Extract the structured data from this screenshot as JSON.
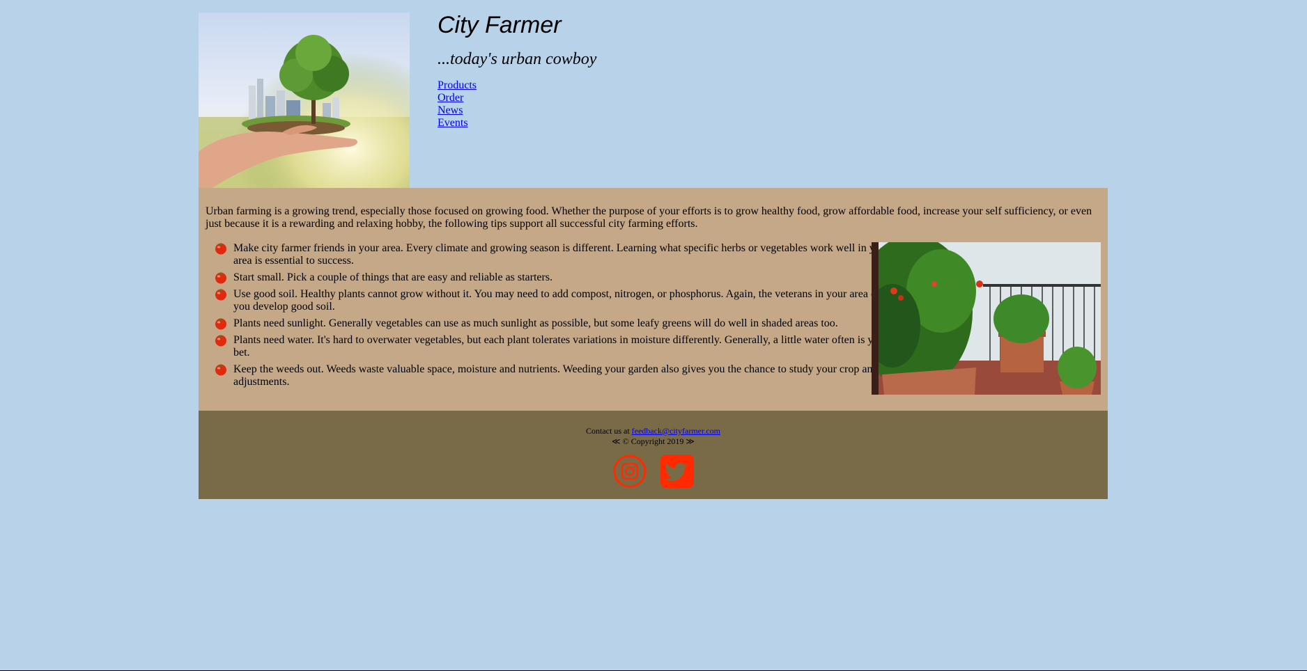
{
  "header": {
    "title": "City Farmer",
    "tagline": "...today's urban cowboy",
    "nav": [
      "Products",
      "Order",
      "News",
      "Events"
    ]
  },
  "main": {
    "intro": "Urban farming is a growing trend, especially those focused on growing food. Whether the purpose of your efforts is to grow healthy food, grow affordable food, increase your self sufficiency, or even just because it is a rewarding and relaxing hobby, the following tips support all successful city farming efforts.",
    "tips": [
      "Make city farmer friends in your area. Every climate and growing season is different. Learning what specific herbs or vegetables work well in your area is essential to success.",
      "Start small. Pick a couple of things that are easy and reliable as starters.",
      "Use good soil. Healthy plants cannot grow without it. You may need to add compost, nitrogen, or phosphorus. Again, the veterans in your area can help you develop good soil.",
      "Plants need sunlight. Generally vegetables can use as much sunlight as possible, but some leafy greens will do well in shaded areas too.",
      "Plants need water. It's hard to overwater vegetables, but each plant tolerates variations in moisture differently. Generally, a little water often is your best bet.",
      "Keep the weeds out. Weeds waste valuable space, moisture and nutrients. Weeding your garden also gives you the chance to study your crop and make adjustments."
    ],
    "bullet_icon": "tomato-icon"
  },
  "footer": {
    "contact_prefix": "Contact us at",
    "email": "feedback@cityfarmer.com",
    "copyright": "≪ © Copyright 2019 ≫",
    "social": [
      {
        "icon": "instagram-icon"
      },
      {
        "icon": "twitter-icon"
      }
    ]
  },
  "colors": {
    "page_bg": "#b8d2ea",
    "main_bg": "#c4a888",
    "footer_bg": "#7a6b48",
    "social_red": "#ff2a00",
    "link": "#0000ee"
  }
}
